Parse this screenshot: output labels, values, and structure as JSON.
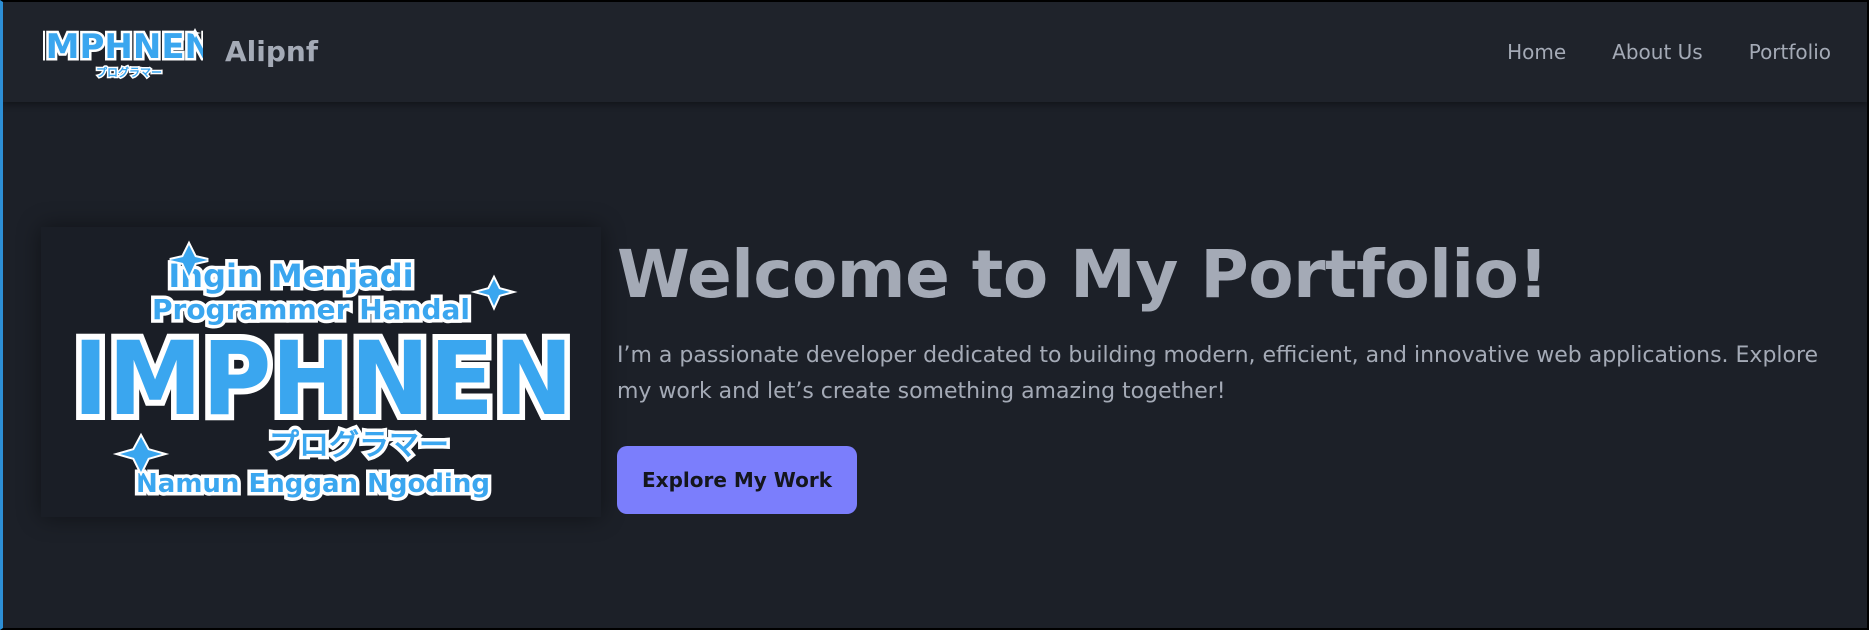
{
  "header": {
    "brand_name": "Alipnf",
    "logo": {
      "icon": "imphnen-logo",
      "title": "IMPHNEN",
      "subtitle": "プログラマー"
    },
    "nav": [
      {
        "label": "Home"
      },
      {
        "label": "About Us"
      },
      {
        "label": "Portfolio"
      }
    ]
  },
  "hero": {
    "image": {
      "icon": "imphnen-banner",
      "top_text_1": "Ingin Menjadi",
      "top_text_2": "Programmer Handal",
      "title": "IMPHNEN",
      "katakana": "プログラマー",
      "bottom_text": "Namun Enggan Ngoding"
    },
    "title": "Welcome to My Portfolio!",
    "description": "I’m a passionate developer dedicated to building modern, efficient, and innovative web applications. Explore my work and let’s create something amazing together!",
    "cta_label": "Explore My Work"
  },
  "colors": {
    "background": "#1c2028",
    "navbar": "#1f232b",
    "text": "#a4aab6",
    "button": "#7b7efc",
    "logo_blue": "#3aa6ef",
    "logo_outline": "#ffffff"
  }
}
